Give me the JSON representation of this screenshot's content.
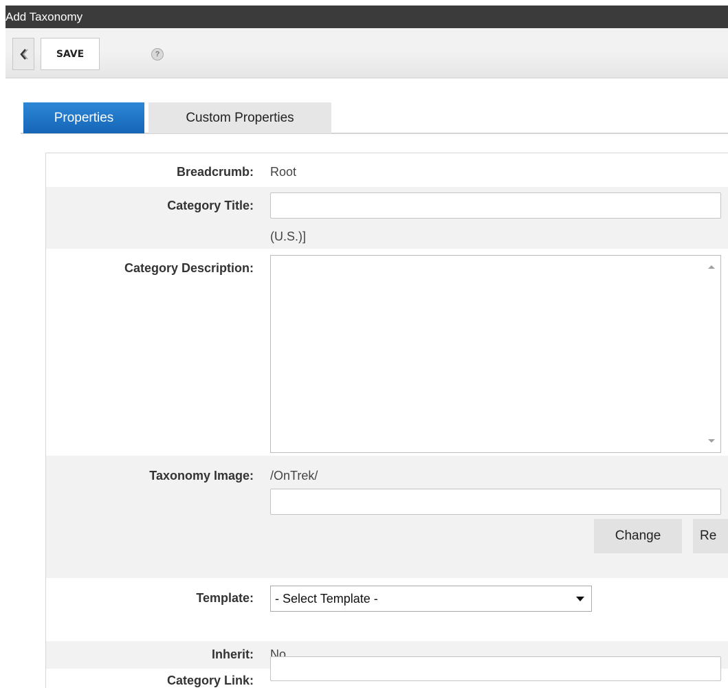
{
  "window": {
    "title": "Add Taxonomy"
  },
  "toolbar": {
    "save_label": "SAVE"
  },
  "tabs": [
    {
      "label": "Properties",
      "active": true
    },
    {
      "label": "Custom Properties",
      "active": false
    }
  ],
  "form": {
    "breadcrumb": {
      "label": "Breadcrumb:",
      "value": "Root"
    },
    "category_title": {
      "label": "Category Title:",
      "value": "",
      "note": "(U.S.)]"
    },
    "category_description": {
      "label": "Category Description:",
      "value": ""
    },
    "taxonomy_image": {
      "label": "Taxonomy Image:",
      "path": "/OnTrek/",
      "value": "",
      "change_label": "Change",
      "remove_label_partial": "Re"
    },
    "template": {
      "label": "Template:",
      "selected": "- Select Template -"
    },
    "inherit": {
      "label": "Inherit:",
      "value": "No"
    },
    "category_link": {
      "label": "Category Link:",
      "value": ""
    }
  },
  "colors": {
    "titlebar": "#3b3b3b",
    "active_tab": "#1f74c8",
    "grey_band": "#f2f2f2"
  }
}
